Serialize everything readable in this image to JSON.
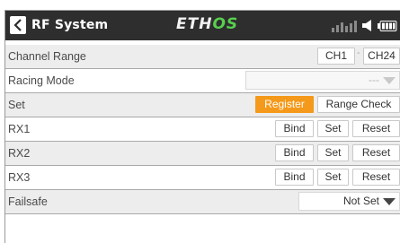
{
  "header": {
    "title": "RF System",
    "logo_part1": "ETH",
    "logo_part2": "OS"
  },
  "rows": {
    "channel_range": {
      "label": "Channel Range",
      "start": "CH1",
      "separator": "-",
      "end": "CH24"
    },
    "racing_mode": {
      "label": "Racing Mode",
      "value": "---"
    },
    "set": {
      "label": "Set",
      "register": "Register",
      "range_check": "Range Check"
    },
    "rx1": {
      "label": "RX1",
      "bind": "Bind",
      "set": "Set",
      "reset": "Reset"
    },
    "rx2": {
      "label": "RX2",
      "bind": "Bind",
      "set": "Set",
      "reset": "Reset"
    },
    "rx3": {
      "label": "RX3",
      "bind": "Bind",
      "set": "Set",
      "reset": "Reset"
    },
    "failsafe": {
      "label": "Failsafe",
      "value": "Not Set"
    }
  },
  "colors": {
    "header_bg": "#2e2e2e",
    "accent_orange": "#f4991a",
    "logo_green": "#57d04f",
    "row_alt_bg": "#ededed"
  },
  "icons": [
    "back-arrow-icon",
    "signal-strength-icon",
    "speaker-icon",
    "battery-icon",
    "dropdown-caret-icon"
  ]
}
